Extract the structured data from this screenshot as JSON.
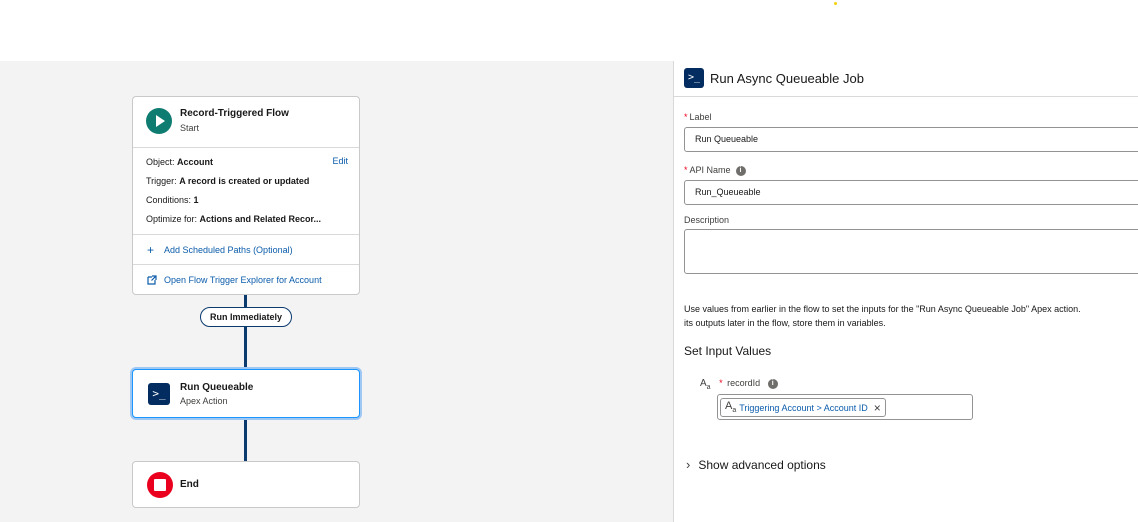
{
  "canvas": {
    "start": {
      "title": "Record-Triggered Flow",
      "subtitle": "Start",
      "edit_label": "Edit",
      "object_label": "Object:",
      "object_value": "Account",
      "trigger_label": "Trigger:",
      "trigger_value": "A record is created or updated",
      "conditions_label": "Conditions:",
      "conditions_value": "1",
      "optimize_label": "Optimize for:",
      "optimize_value": "Actions and Related Recor...",
      "scheduled_paths_link": "Add Scheduled Paths (Optional)",
      "trigger_explorer_link": "Open Flow Trigger Explorer for Account"
    },
    "path_label": "Run Immediately",
    "action": {
      "title": "Run Queueable",
      "subtitle": "Apex Action"
    },
    "end": {
      "title": "End"
    }
  },
  "panel": {
    "title": "Run Async Queueable Job",
    "label_field": {
      "label": "Label",
      "value": "Run Queueable"
    },
    "api_name_field": {
      "label": "API Name",
      "value": "Run_Queueable"
    },
    "description_field": {
      "label": "Description",
      "value": ""
    },
    "help_line1": "Use values from earlier in the flow to set the inputs for the \"Run Async Queueable Job\" Apex action.",
    "help_line2": "its outputs later in the flow, store them in variables.",
    "section_title": "Set Input Values",
    "param": {
      "label": "recordId",
      "token": "Triggering Account > Account ID"
    },
    "advanced_label": "Show advanced options"
  },
  "icons": {
    "start": "play-icon",
    "action": "apex-terminal-icon",
    "end": "stop-icon",
    "add": "plus-icon",
    "external": "external-link-icon",
    "info": "info-icon",
    "text_type": "text-type-icon",
    "remove": "close-icon",
    "expand": "chevron-right-icon"
  },
  "colors": {
    "start_icon": "#0f7c72",
    "end_icon": "#ea001e",
    "apex_icon": "#032d60",
    "connector": "#0b3a6e",
    "link": "#0b5cab",
    "selected_border": "#1b96ff"
  }
}
